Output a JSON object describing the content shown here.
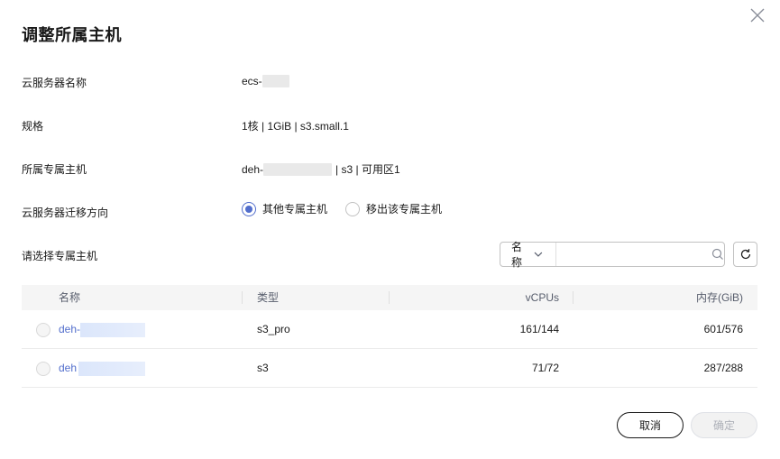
{
  "dialog": {
    "title": "调整所属主机",
    "close_icon": "close-icon"
  },
  "info": {
    "server_name_label": "云服务器名称",
    "server_name_value": "ecs-",
    "spec_label": "规格",
    "spec_value": "1核 | 1GiB | s3.small.1",
    "host_label": "所属专属主机",
    "host_prefix": "deh-",
    "host_suffix": "| s3 | 可用区1",
    "direction_label": "云服务器迁移方向"
  },
  "direction": {
    "options": [
      {
        "label": "其他专属主机",
        "checked": true
      },
      {
        "label": "移出该专属主机",
        "checked": false
      }
    ]
  },
  "select_host": {
    "label": "请选择专属主机",
    "search_field": "名称",
    "search_placeholder": "",
    "search_icon": "search-icon",
    "refresh_icon": "refresh-icon"
  },
  "table": {
    "headers": [
      "名称",
      "类型",
      "vCPUs",
      "内存(GiB)"
    ],
    "rows": [
      {
        "name": "deh-",
        "type": "s3_pro",
        "vcpus": "161/144",
        "memory": "601/576"
      },
      {
        "name": "deh",
        "type": "s3",
        "vcpus": "71/72",
        "memory": "287/288"
      }
    ]
  },
  "footer": {
    "cancel_label": "取消",
    "ok_label": "确定"
  },
  "colors": {
    "accent": "#526ecc",
    "text": "#191919",
    "header_bg": "#f5f5f5"
  }
}
